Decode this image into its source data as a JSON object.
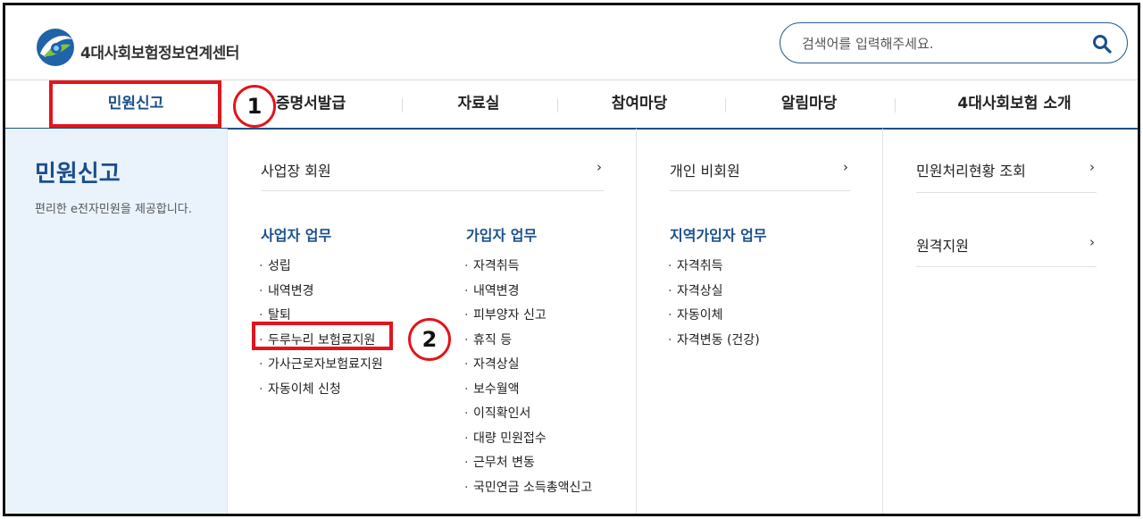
{
  "header": {
    "brand": "4대사회보험정보연계센터",
    "search_placeholder": "검색어를 입력해주세요."
  },
  "nav": {
    "items": [
      "민원신고",
      "증명서발급",
      "자료실",
      "참여마당",
      "알림마당",
      "4대사회보험 소개"
    ]
  },
  "left_panel": {
    "title": "민원신고",
    "description": "편리한 e전자민원을 제공합니다."
  },
  "menu": {
    "business_member": "사업장 회원",
    "individual_nonmember": "개인 비회원",
    "status_inquiry": "민원처리현황 조회",
    "remote_support": "원격지원",
    "business_tasks": {
      "title": "사업자 업무",
      "items": [
        "성립",
        "내역변경",
        "탈퇴",
        "두루누리 보험료지원",
        "가사근로자보험료지원",
        "자동이체 신청"
      ]
    },
    "subscriber_tasks": {
      "title": "가입자 업무",
      "items": [
        "자격취득",
        "내역변경",
        "피부양자 신고",
        "휴직 등",
        "자격상실",
        "보수월액",
        "이직확인서",
        "대량 민원접수",
        "근무처 변동",
        "국민연금 소득총액신고"
      ]
    },
    "regional_tasks": {
      "title": "지역가입자 업무",
      "items": [
        "자격취득",
        "자격상실",
        "자동이체",
        "자격변동 (건강)"
      ]
    }
  },
  "annotations": {
    "step1": "1",
    "step2": "2"
  },
  "colors": {
    "brand_blue": "#1a4f8b",
    "highlight_red": "#e3141b",
    "panel_bg": "#eaf3fc"
  }
}
